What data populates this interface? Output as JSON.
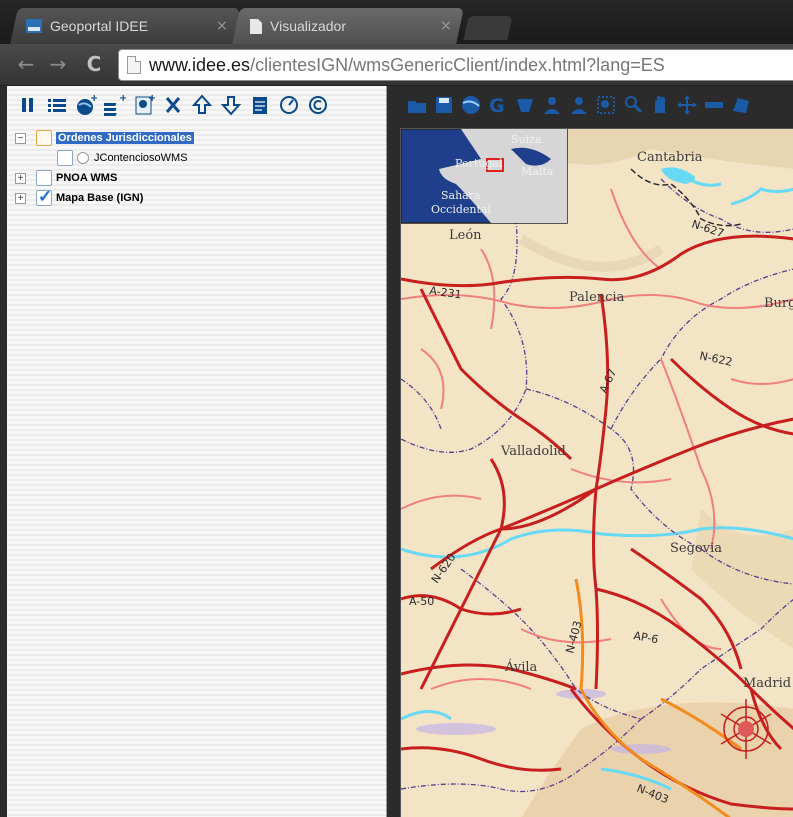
{
  "browser": {
    "tabs": [
      {
        "title": "Geoportal IDEE",
        "close": "×"
      },
      {
        "title": "Visualizador",
        "close": "×"
      }
    ],
    "url": {
      "host": "www.idee.es",
      "path": "/clientesIGN/wmsGenericClient/index.html?lang=ES"
    }
  },
  "icons": {
    "back": "←",
    "forward": "→",
    "reload": "C"
  },
  "layer_tree": [
    {
      "label": "Ordenes Jurisdiccionales",
      "expander": "−"
    },
    {
      "label": "JContenciosoWMS"
    },
    {
      "label": "PNOA WMS",
      "expander": "+"
    },
    {
      "label": "Mapa Base (IGN)",
      "expander": "+"
    }
  ],
  "map": {
    "overview_labels": [
      "Suiza",
      "Portugal",
      "Malta",
      "Sahara",
      "Occidental"
    ],
    "places": [
      "Cantabria",
      "León",
      "Palencia",
      "Burg",
      "Valladolid",
      "Segovia",
      "Ávila",
      "Madrid"
    ],
    "roads": [
      "N-627",
      "A-231",
      "A-67",
      "N-622",
      "N-620",
      "A-50",
      "N-403",
      "AP-6",
      "N-403"
    ]
  },
  "colors": {
    "accent": "#316ac5",
    "road_major": "#c81e1e",
    "road_secondary": "#f08080",
    "highway_orange": "#f28c1e",
    "water": "#66d9f5",
    "border_purple": "#5b3a8c"
  }
}
